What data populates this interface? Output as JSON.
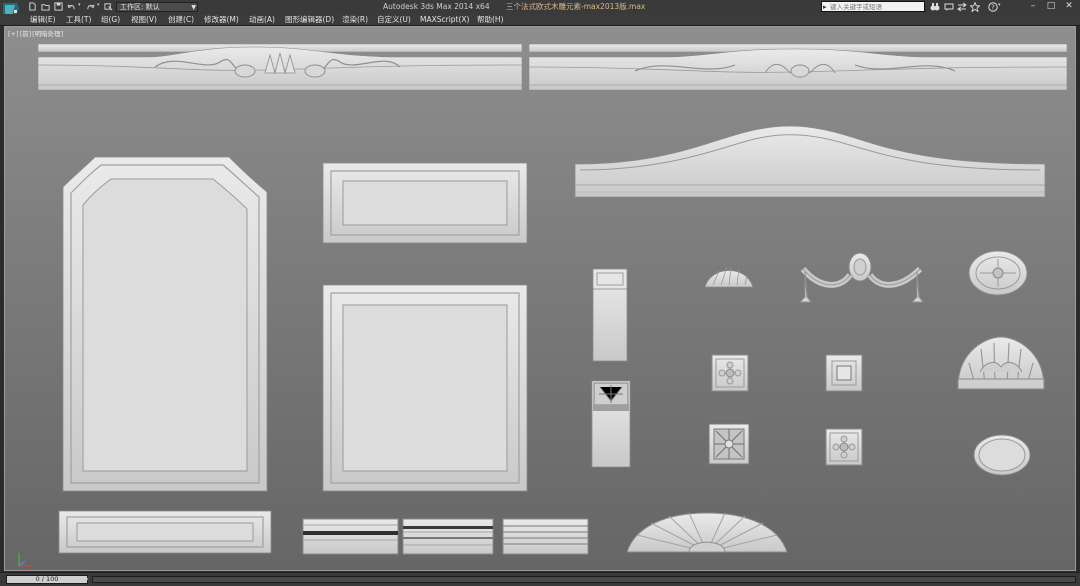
{
  "titlebar": {
    "workspace_value": "工作区: 默认",
    "app_title": "Autodesk 3ds Max  2014 x64",
    "document_title": "三个法式欧式木雕元素-max2013版.max",
    "search_placeholder": "键入关键字或短语",
    "icons": [
      "app-logo",
      "new-icon",
      "open-icon",
      "save-icon",
      "undo-icon",
      "redo-icon",
      "hold-icon",
      "binoculars-icon",
      "communication-icon",
      "exchange-icon",
      "favorites-icon",
      "help-icon"
    ]
  },
  "menu": {
    "items": [
      {
        "label": "编辑(E)"
      },
      {
        "label": "工具(T)"
      },
      {
        "label": "组(G)"
      },
      {
        "label": "视图(V)"
      },
      {
        "label": "创建(C)"
      },
      {
        "label": "修改器(M)"
      },
      {
        "label": "动画(A)"
      },
      {
        "label": "图形编辑器(D)"
      },
      {
        "label": "渲染(R)"
      },
      {
        "label": "自定义(U)"
      },
      {
        "label": "MAXScript(X)"
      },
      {
        "label": "帮助(H)"
      }
    ]
  },
  "viewport": {
    "label_parts": [
      "[+]",
      "[前]",
      "[明暗处理]"
    ],
    "objects": [
      "carved-crown-rail",
      "carved-crown-rail",
      "arched-panel-tall",
      "raised-panel-wide",
      "raised-panel-square",
      "arched-pediment-rail",
      "baseboard-panel",
      "pilaster",
      "carved-pilaster",
      "shell-applique",
      "swag-applique",
      "oval-rosette",
      "rosette-square",
      "recessed-square",
      "half-shell-fan",
      "carved-square",
      "rosette-square",
      "oval-plaque",
      "molding-profile",
      "molding-profile",
      "molding-profile",
      "sunburst-fan"
    ],
    "colors": {
      "background_top": "#8e8e8e",
      "background_bottom": "#666666",
      "model": "#d6d6d6"
    }
  },
  "statusbar": {
    "timeline_value": "0 / 100"
  }
}
